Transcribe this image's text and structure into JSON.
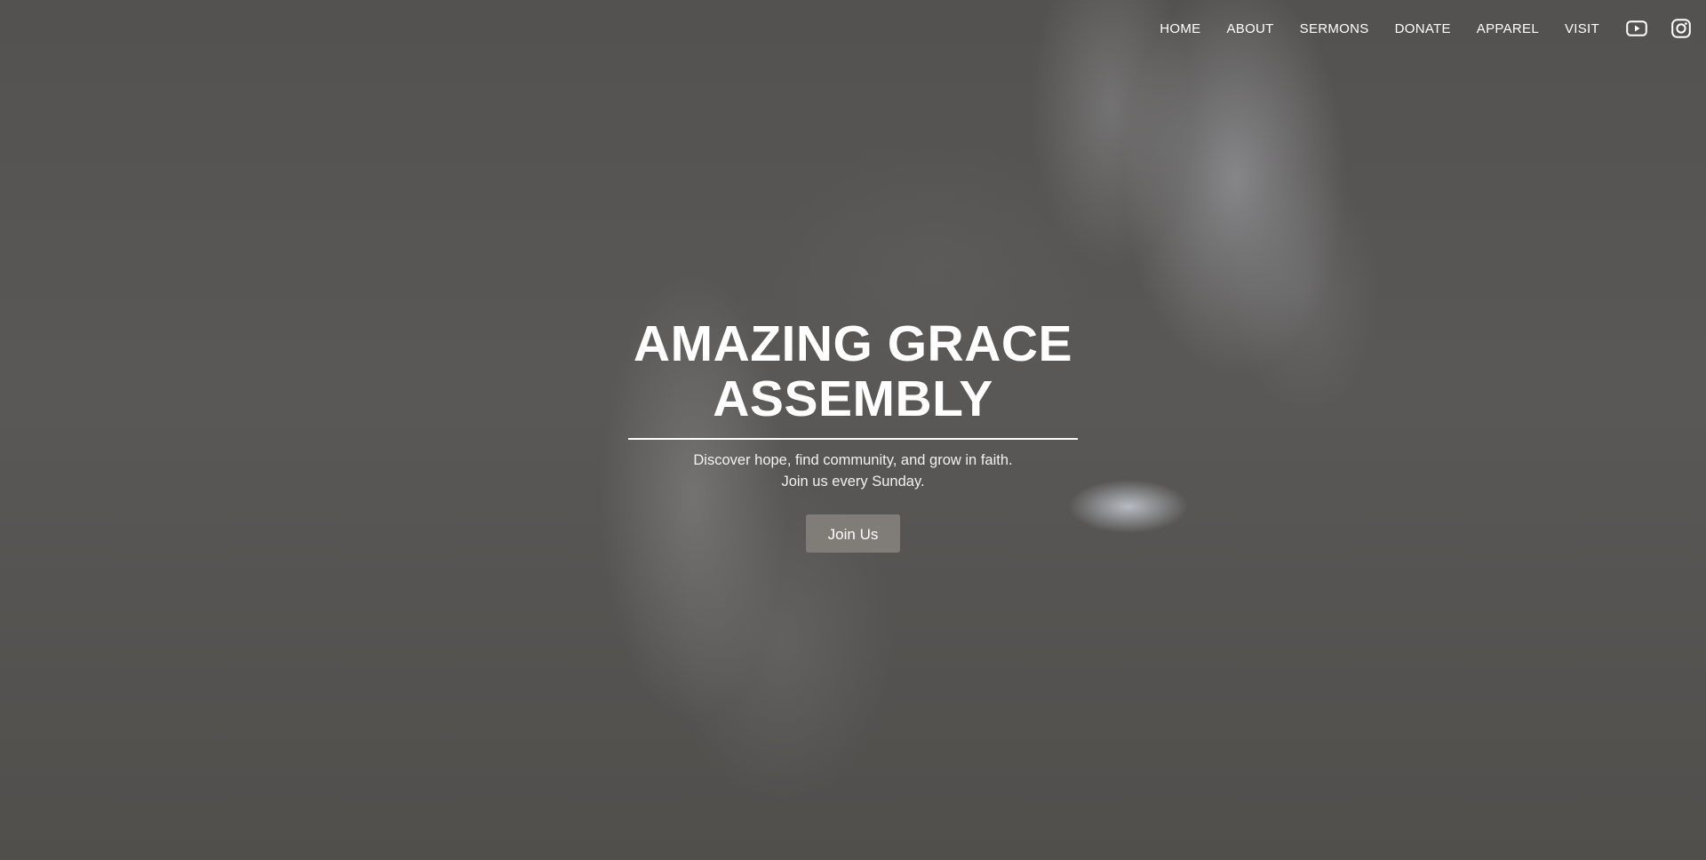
{
  "nav": {
    "items": [
      {
        "label": "HOME"
      },
      {
        "label": "ABOUT"
      },
      {
        "label": "SERMONS"
      },
      {
        "label": "DONATE"
      },
      {
        "label": "APPAREL"
      },
      {
        "label": "VISIT"
      }
    ],
    "social": [
      {
        "icon": "youtube-icon"
      },
      {
        "icon": "instagram-icon"
      }
    ]
  },
  "hero": {
    "title_line1": "AMAZING GRACE",
    "title_line2": "ASSEMBLY",
    "tagline_line1": "Discover hope, find community, and grow in faith.",
    "tagline_line2": "Join us every Sunday.",
    "cta_label": "Join Us"
  },
  "colors": {
    "button_bg": "#807d78",
    "text": "#ffffff",
    "background": "#555350"
  }
}
